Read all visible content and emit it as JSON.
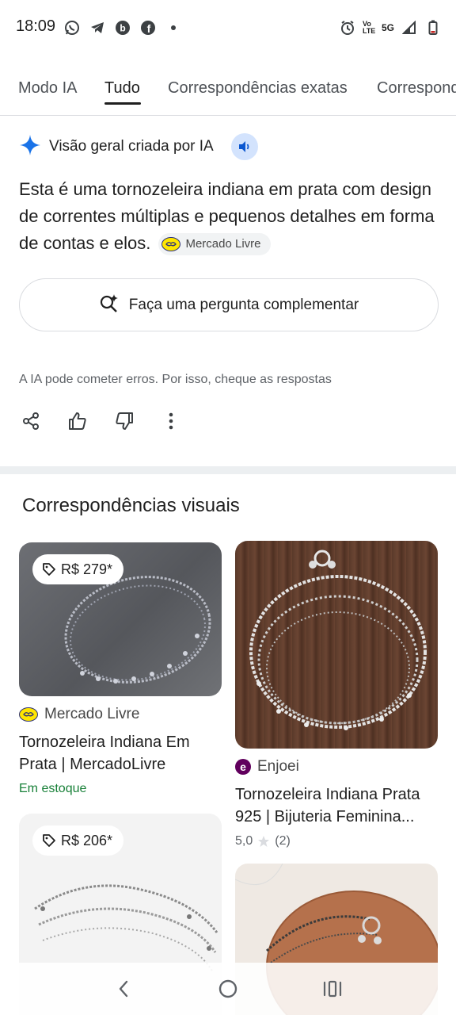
{
  "status_bar": {
    "time": "18:09",
    "volte": "Vo LTE",
    "network": "5G"
  },
  "tabs": [
    {
      "label": "Modo IA"
    },
    {
      "label": "Tudo"
    },
    {
      "label": "Correspondências exatas"
    },
    {
      "label": "Correspondências"
    }
  ],
  "ai_overview": {
    "title": "Visão geral criada por IA",
    "text": "Esta é uma tornozeleira indiana em prata com design de correntes múltiplas e pequenos detalhes em forma de contas e elos.",
    "source_chip": "Mercado Livre",
    "followup_label": "Faça uma pergunta complementar",
    "disclaimer": "A IA pode cometer erros. Por isso, cheque as respostas"
  },
  "visual_matches": {
    "title": "Correspondências visuais",
    "cards": [
      {
        "price": "R$ 279*",
        "source": "Mercado Livre",
        "title": "Tornozeleira Indiana Em Prata | MercadoLivre",
        "stock": "Em estoque"
      },
      {
        "source": "Enjoei",
        "title": "Tornozeleira Indiana Prata 925 | Bijuteria Feminina...",
        "rating_value": "5,0",
        "rating_count": "(2)"
      },
      {
        "price": "R$ 206*"
      },
      {}
    ]
  },
  "colors": {
    "accent": "#1a73e8",
    "text": "#1f1f1f",
    "secondary": "#5f6368",
    "stock_green": "#188038"
  }
}
